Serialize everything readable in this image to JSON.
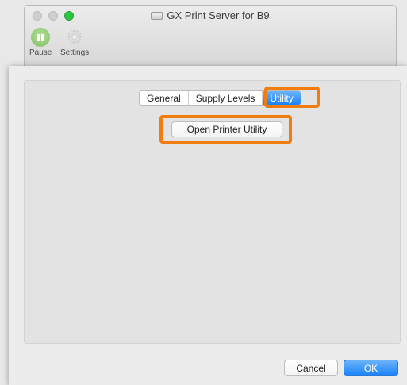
{
  "window": {
    "title": "GX Print Server for B9",
    "toolbar": {
      "pause_label": "Pause",
      "settings_label": "Settings"
    }
  },
  "dialog": {
    "tabs": [
      {
        "label": "General"
      },
      {
        "label": "Supply Levels"
      },
      {
        "label": "Utility",
        "active": true
      }
    ],
    "open_utility_label": "Open Printer Utility",
    "cancel_label": "Cancel",
    "ok_label": "OK"
  },
  "colors": {
    "accent": "#1a82fb",
    "highlight": "#f17c0f",
    "pause_green": "#7fbf5c"
  },
  "icons": {
    "printer": "printer-icon",
    "pause": "pause-icon",
    "settings": "gear-icon"
  }
}
